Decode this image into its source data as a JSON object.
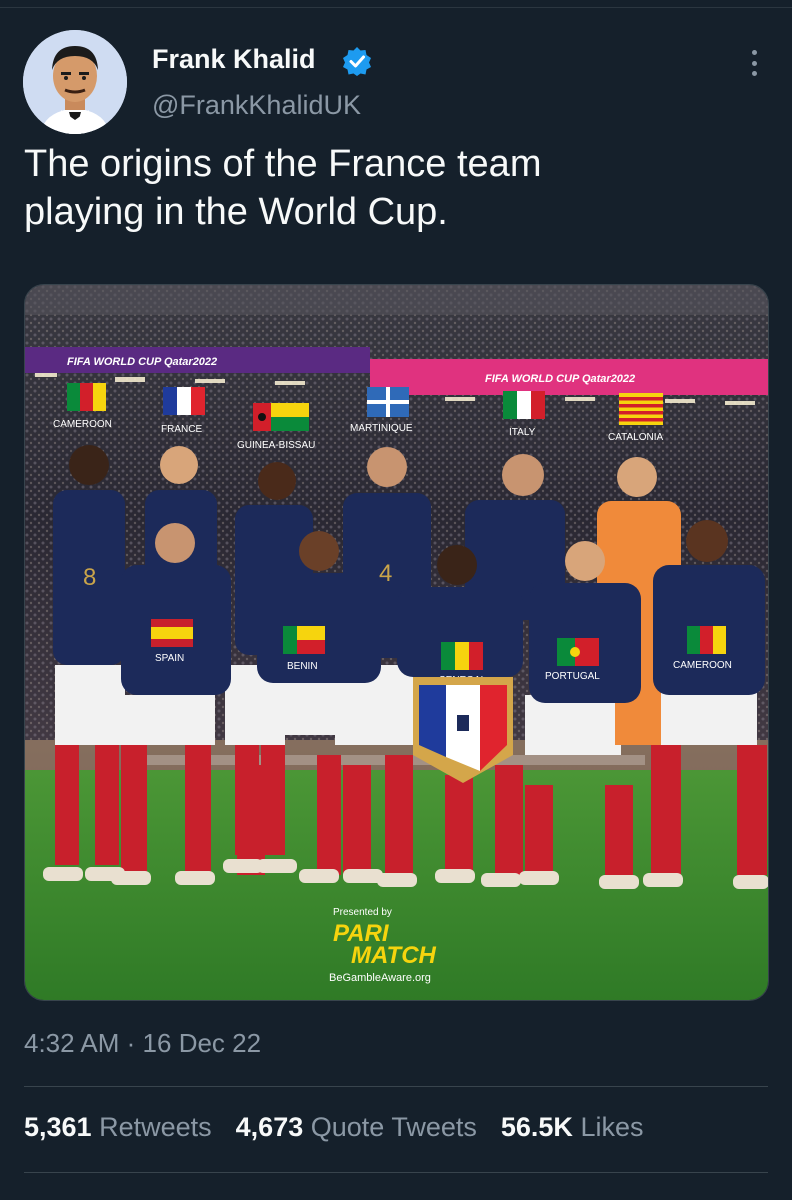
{
  "author": {
    "name": "Frank Khalid",
    "handle": "@FrankKhalidUK",
    "verified": true,
    "avatar_icon": "cartoon-avatar"
  },
  "tweet": {
    "text_line1": "The origins of the France team",
    "text_line2": "playing in the World Cup."
  },
  "media": {
    "banner_left": "FIFA WORLD CUP Qatar2022",
    "banner_right": "FIFA WORLD CUP Qatar2022",
    "flags": {
      "cameroon_top": "CAMEROON",
      "france": "FRANCE",
      "guinea_bissau": "GUINEA-BISSAU",
      "martinique": "MARTINIQUE",
      "italy": "ITALY",
      "catalonia": "CATALONIA",
      "spain": "SPAIN",
      "benin": "BENIN",
      "senegal": "SENEGAL",
      "portugal": "PORTUGAL",
      "cameroon_right": "CAMEROON"
    },
    "jersey_numbers": {
      "left": "8",
      "center": "4"
    },
    "sponsor_presented": "Presented by",
    "sponsor_line1": "PARI",
    "sponsor_line2": "MATCH",
    "sponsor_tagline": "BeGambleAware.org"
  },
  "meta": {
    "time": "4:32 AM",
    "separator": "·",
    "date": "16 Dec 22"
  },
  "stats": {
    "retweets_count": "5,361",
    "retweets_label": "Retweets",
    "quotes_count": "4,673",
    "quotes_label": "Quote Tweets",
    "likes_count": "56.5K",
    "likes_label": "Likes"
  },
  "colors": {
    "background": "#15202b",
    "text_primary": "#f7f9f9",
    "text_secondary": "#8b98a5",
    "verified_blue": "#1d9bf0",
    "france_navy": "#1c2a5a",
    "sock_red": "#c8202c",
    "pitch_green": "#3f8c2e"
  }
}
